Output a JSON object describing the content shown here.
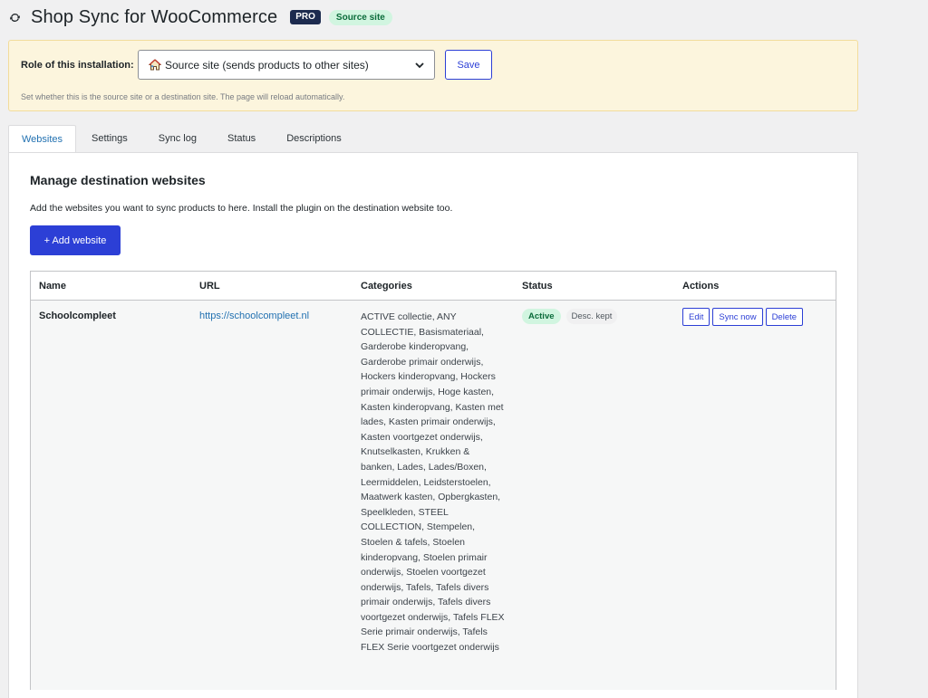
{
  "header": {
    "title": "Shop Sync for WooCommerce",
    "badge_pro": "PRO",
    "badge_role": "Source site",
    "icon": "sync-icon"
  },
  "role": {
    "label": "Role of this installation:",
    "selected": "Source site (sends products to other sites)",
    "save_label": "Save",
    "help": "Set whether this is the source site or a destination site. The page will reload automatically."
  },
  "tabs": [
    {
      "label": "Websites",
      "active": true
    },
    {
      "label": "Settings",
      "active": false
    },
    {
      "label": "Sync log",
      "active": false
    },
    {
      "label": "Status",
      "active": false
    },
    {
      "label": "Descriptions",
      "active": false
    }
  ],
  "panel": {
    "title": "Manage destination websites",
    "description": "Add the websites you want to sync products to here. Install the plugin on the destination website too.",
    "add_button": "+ Add website"
  },
  "table": {
    "columns": [
      "Name",
      "URL",
      "Categories",
      "Status",
      "Actions"
    ],
    "rows": [
      {
        "name": "Schoolcompleet",
        "url": "https://schoolcompleet.nl",
        "categories": "ACTIVE collectie, ANY COLLECTIE, Basismateriaal, Garderobe kinderopvang, Garderobe primair onderwijs, Hockers kinderopvang, Hockers primair onderwijs, Hoge kasten, Kasten kinderopvang, Kasten met lades, Kasten primair onderwijs, Kasten voortgezet onderwijs, Knutselkasten, Krukken & banken, Lades, Lades/Boxen, Leermiddelen, Leidsterstoelen, Maatwerk kasten, Opbergkasten, Speelkleden, STEEL COLLECTION, Stempelen, Stoelen & tafels, Stoelen kinderopvang, Stoelen primair onderwijs, Stoelen voortgezet onderwijs, Tafels, Tafels divers primair onderwijs, Tafels divers voortgezet onderwijs, Tafels FLEX Serie primair onderwijs, Tafels FLEX Serie voortgezet onderwijs",
        "status": "Active",
        "desc_status": "Desc. kept",
        "actions": [
          "Edit",
          "Sync now",
          "Delete"
        ]
      }
    ]
  },
  "colors": {
    "accent": "#2c3fd6",
    "link": "#2271b1",
    "notice_bg": "#fcf5dd",
    "active_pill": "#d1f5e0",
    "pro_badge": "#1d2b4f"
  }
}
